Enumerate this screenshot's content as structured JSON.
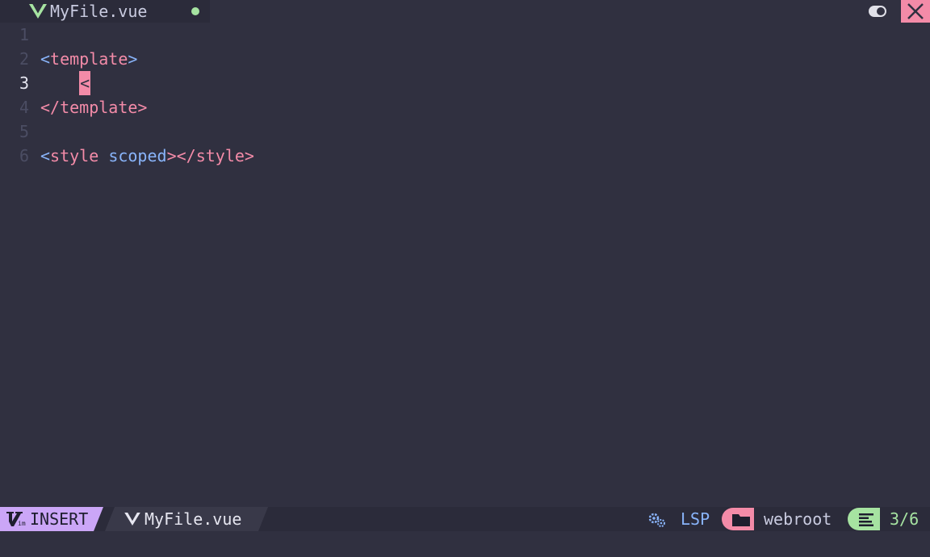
{
  "tabbar": {
    "file_name": "MyFile.vue",
    "file_icon": "vue-icon",
    "modified_indicator": "dot",
    "toggle_icon": "toggle-icon",
    "close_icon": "close-icon"
  },
  "editor": {
    "lines": [
      {
        "number": "1",
        "current": false,
        "text": ""
      },
      {
        "number": "2",
        "current": false,
        "text": "<template>"
      },
      {
        "number": "3",
        "current": true,
        "text": "    <"
      },
      {
        "number": "4",
        "current": false,
        "text": "</template>"
      },
      {
        "number": "5",
        "current": false,
        "text": ""
      },
      {
        "number": "6",
        "current": false,
        "text": "<style scoped></style>"
      }
    ],
    "tokens": {
      "l2_open": "<",
      "l2_name": "template",
      "l2_close": ">",
      "l3_indent": "    ",
      "l3_cursor": "<",
      "l4_open": "</",
      "l4_name": "template",
      "l4_close": ">",
      "l6_open": "<",
      "l6_name": "style",
      "l6_attr": "scoped",
      "l6_gt": ">",
      "l6_open2": "</",
      "l6_name2": "style",
      "l6_close2": ">"
    }
  },
  "statusline": {
    "mode": "INSERT",
    "file_name": "MyFile.vue",
    "lsp_label": "LSP",
    "root": "webroot",
    "position": "3/6"
  },
  "colors": {
    "background": "#303040",
    "pink": "#f38ba8",
    "blue": "#89b4fa",
    "green": "#a6e3a1",
    "mauve": "#cba6f7"
  }
}
